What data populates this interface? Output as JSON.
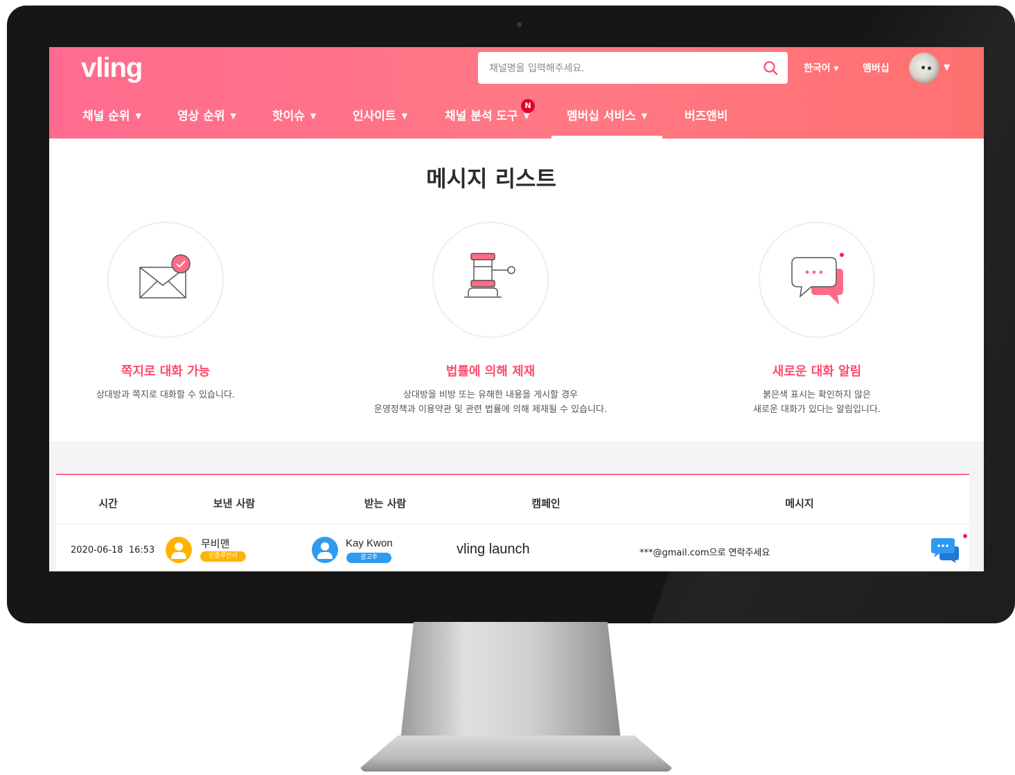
{
  "header": {
    "logo": "vling",
    "search": {
      "placeholder": "채널명을 입력해주세요."
    },
    "language": "한국어 ▾",
    "membership": "멤버십",
    "nav": [
      {
        "label": "채널 순위",
        "caret": "▼"
      },
      {
        "label": "영상 순위",
        "caret": "▼"
      },
      {
        "label": "핫이슈",
        "caret": "▼"
      },
      {
        "label": "인사이트",
        "caret": "▼"
      },
      {
        "label": "채널 분석 도구",
        "caret": "▼",
        "badge": "N"
      },
      {
        "label": "멤버십 서비스",
        "caret": "▼",
        "active": true
      },
      {
        "label": "버즈앤비"
      }
    ]
  },
  "page": {
    "title": "메시지 리스트",
    "features": [
      {
        "title": "쪽지로 대화 가능",
        "desc_line1": "상대방과 쪽지로 대화할 수 있습니다.",
        "desc_line2": ""
      },
      {
        "title": "법률에 의해 제재",
        "desc_line1": "상대방을 비방 또는 유해한 내용을 게시할 경우",
        "desc_line2": "운영정책과 이용약관 및 관련 법률에 의해 제재될 수 있습니다."
      },
      {
        "title": "새로운 대화 알림",
        "desc_line1": "붉은색 표시는 확인하지 않은",
        "desc_line2": "새로운 대화가 있다는 알림입니다."
      }
    ]
  },
  "table": {
    "headers": {
      "time": "시간",
      "sender": "보낸 사람",
      "receiver": "받는 사람",
      "campaign": "캠페인",
      "message": "메시지"
    },
    "rows": [
      {
        "date": "2020-06-18",
        "time": "16:53",
        "sender": {
          "name": "무비맨",
          "tag": "인플루언서"
        },
        "receiver": {
          "name": "Kay Kwon",
          "tag": "광고주"
        },
        "campaign": "vling launch",
        "message": "***@gmail.com으로 연락주세요"
      }
    ]
  },
  "colors": {
    "brand": "#ff6b86",
    "accent_text": "#ff4b6e",
    "sender_avatar": "#ffb300",
    "receiver_avatar": "#2e9bf0",
    "unread_dot": "#ff1e3c"
  }
}
